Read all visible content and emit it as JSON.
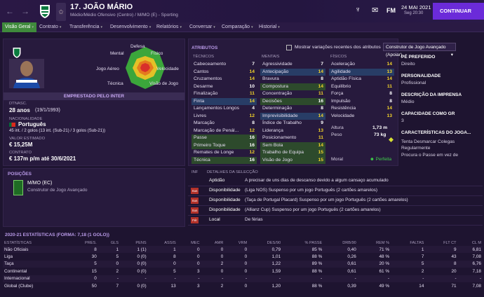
{
  "header": {
    "player_name": "17. JOÃO MÁRIO",
    "subtitle": "Médio/Médio Ofensivo (Centro) / M/MO (E) - Sporting",
    "manager": "FM",
    "date": "24 MAI 2021",
    "day": "Seg 20:30",
    "continue": "CONTINUAR"
  },
  "tabs": [
    "Visão Geral",
    "Contrato",
    "Transferência",
    "Desenvolvimento",
    "Relatórios",
    "Conversar",
    "Comparação",
    "Historial"
  ],
  "radar": {
    "labels": {
      "top": "Defesa",
      "tr": "Físico",
      "r": "Velocidade",
      "br": "Visão de Jogo",
      "bl": "Técnica",
      "l": "Jogo Aéreo",
      "tl": "Mental"
    }
  },
  "loan_banner": "EMPRESTADO PELO INTER",
  "profile": {
    "dob_label": "DTNASC.",
    "age": "28 anos",
    "dob": "(19/1/1993)",
    "nat_label": "NACIONALIDADE",
    "nat": "Português",
    "caps": "45 int. / 2 golos (13 int. (Sub-21) / 3 golos (Sub-21))",
    "value_label": "VALOR ESTIMADO",
    "value": "€ 15,25M",
    "contract_label": "CONTRATO",
    "contract": "€ 137m p/m até 30/6/2021"
  },
  "attributes": {
    "title": "ATRIBUTOS",
    "toggle_label": "Mostrar variações recentes dos atributos",
    "preset": "Construtor de Jogo Avançado (Apoiar)",
    "tech_title": "TÉCNICOS",
    "mental_title": "MENTAIS",
    "phys_title": "FÍSICOS",
    "technical": [
      [
        "Cabeceamento",
        "7",
        ""
      ],
      [
        "Cantos",
        "14",
        ""
      ],
      [
        "Cruzamentos",
        "14",
        ""
      ],
      [
        "Desarme",
        "10",
        ""
      ],
      [
        "Finalização",
        "11",
        ""
      ],
      [
        "Finta",
        "14",
        "hb"
      ],
      [
        "Lançamentos Longos",
        "4",
        ""
      ],
      [
        "Livres",
        "12",
        ""
      ],
      [
        "Marcação",
        "8",
        ""
      ],
      [
        "Marcação de Penál...",
        "12",
        ""
      ],
      [
        "Passe",
        "16",
        "hl"
      ],
      [
        "Primeiro Toque",
        "16",
        "hl"
      ],
      [
        "Remates de Longe",
        "12",
        ""
      ],
      [
        "Técnica",
        "16",
        "hl"
      ]
    ],
    "mental": [
      [
        "Agressividade",
        "7",
        ""
      ],
      [
        "Antecipação",
        "14",
        "hb"
      ],
      [
        "Bravura",
        "8",
        ""
      ],
      [
        "Compostura",
        "14",
        "hl"
      ],
      [
        "Concentração",
        "11",
        ""
      ],
      [
        "Decisões",
        "16",
        "hl"
      ],
      [
        "Determinação",
        "8",
        ""
      ],
      [
        "Imprevisibilidade",
        "14",
        "hb"
      ],
      [
        "Índice de Trabalho",
        "9",
        ""
      ],
      [
        "Liderança",
        "13",
        ""
      ],
      [
        "Posicionamento",
        "11",
        ""
      ],
      [
        "Sem Bola",
        "14",
        "hl"
      ],
      [
        "Trabalho de Equipa",
        "15",
        "hl"
      ],
      [
        "Visão de Jogo",
        "15",
        "hl"
      ]
    ],
    "physical": [
      [
        "Aceleração",
        "14",
        ""
      ],
      [
        "Agilidade",
        "13",
        "hb"
      ],
      [
        "Aptidão Física",
        "14",
        ""
      ],
      [
        "Equilíbrio",
        "11",
        ""
      ],
      [
        "Força",
        "8",
        ""
      ],
      [
        "Impulsão",
        "8",
        ""
      ],
      [
        "Resistência",
        "14",
        ""
      ],
      [
        "Velocidade",
        "13",
        ""
      ]
    ],
    "height_label": "Altura",
    "height": "1,73 m",
    "weight_label": "Peso",
    "weight": "73 kg",
    "morale_label": "Moral",
    "morale": "Perfeita"
  },
  "side": {
    "foot_label": "PÉ PREFERIDO",
    "foot": "Direito",
    "pers_label": "PERSONALIDADE",
    "pers": "Profissional",
    "media_label": "DESCRIÇÃO DA IMPRENSA",
    "media": "Médio",
    "gk_label": "CAPACIDADE COMO GR",
    "gk": "3",
    "traits_label": "CARACTERÍSTICAS DO JOGA...",
    "traits": [
      "Tenta Desmarcar Colegas Regularmente",
      "Procura o Passe em vez de"
    ]
  },
  "positions": {
    "title": "POSIÇÕES",
    "main": "M/MO (EC)",
    "role": "Construtor de Jogo Avançado"
  },
  "selection": {
    "inf": "INF",
    "title": "DETALHES DA SELECÇÃO",
    "rows": [
      [
        "",
        "Aptidão",
        "A precisar de uns dias de descanso devido a algum cansaço acumulado"
      ],
      [
        "Sus",
        "Disponibilidade",
        "(Liga NOS) Suspenso por um jogo Português (2 cartões amarelos)"
      ],
      [
        "Sus",
        "Disponibilidade",
        "(Taça de Portugal Placard) Suspenso por um jogo Português (2 cartões amarelos)"
      ],
      [
        "Sus",
        "Disponibilidade",
        "(Allianz Cup) Suspenso por um jogo Português (2 cartões amarelos)"
      ],
      [
        "Fér",
        "Local",
        "De férias"
      ]
    ]
  },
  "stats": {
    "title": "2020-21 ESTATÍSTICAS (FORMA: 7,18 (1 GOLO))",
    "headers": [
      "ESTATÍSTICAS",
      "PRES.",
      "GLS",
      "PENS",
      "ASSIS",
      "MEC",
      "AMR",
      "VRM",
      "DES/90",
      "% PASSE",
      "DRB/90",
      "REM %",
      "FALTAS",
      "FLT CT",
      "CL M"
    ],
    "rows": [
      [
        "Não Oficiais",
        "8",
        "1",
        "1 (1)",
        "1",
        "0",
        "0",
        "0",
        "0,79",
        "85 %",
        "0,40",
        "71 %",
        "1",
        "9",
        "6,81"
      ],
      [
        "Liga",
        "30",
        "5",
        "0 (0)",
        "8",
        "0",
        "0",
        "0",
        "1,01",
        "88 %",
        "0,26",
        "48 %",
        "7",
        "43",
        "7,08"
      ],
      [
        "Taça",
        "5",
        "0",
        "0 (0)",
        "0",
        "0",
        "2",
        "0",
        "1,22",
        "89 %",
        "0,61",
        "20 %",
        "5",
        "8",
        "6,76"
      ],
      [
        "Continental",
        "15",
        "2",
        "0 (0)",
        "5",
        "3",
        "0",
        "0",
        "1,59",
        "88 %",
        "0,61",
        "61 %",
        "2",
        "20",
        "7,18"
      ],
      [
        "Internacional",
        "0",
        "-",
        "-",
        "-",
        "-",
        "-",
        "-",
        "-",
        "-",
        "-",
        "-",
        "-",
        "-",
        "-"
      ],
      [
        "Global (Clube)",
        "50",
        "7",
        "0 (0)",
        "13",
        "3",
        "2",
        "0",
        "1,20",
        "88 %",
        "0,39",
        "49 %",
        "14",
        "71",
        "7,08"
      ]
    ]
  }
}
